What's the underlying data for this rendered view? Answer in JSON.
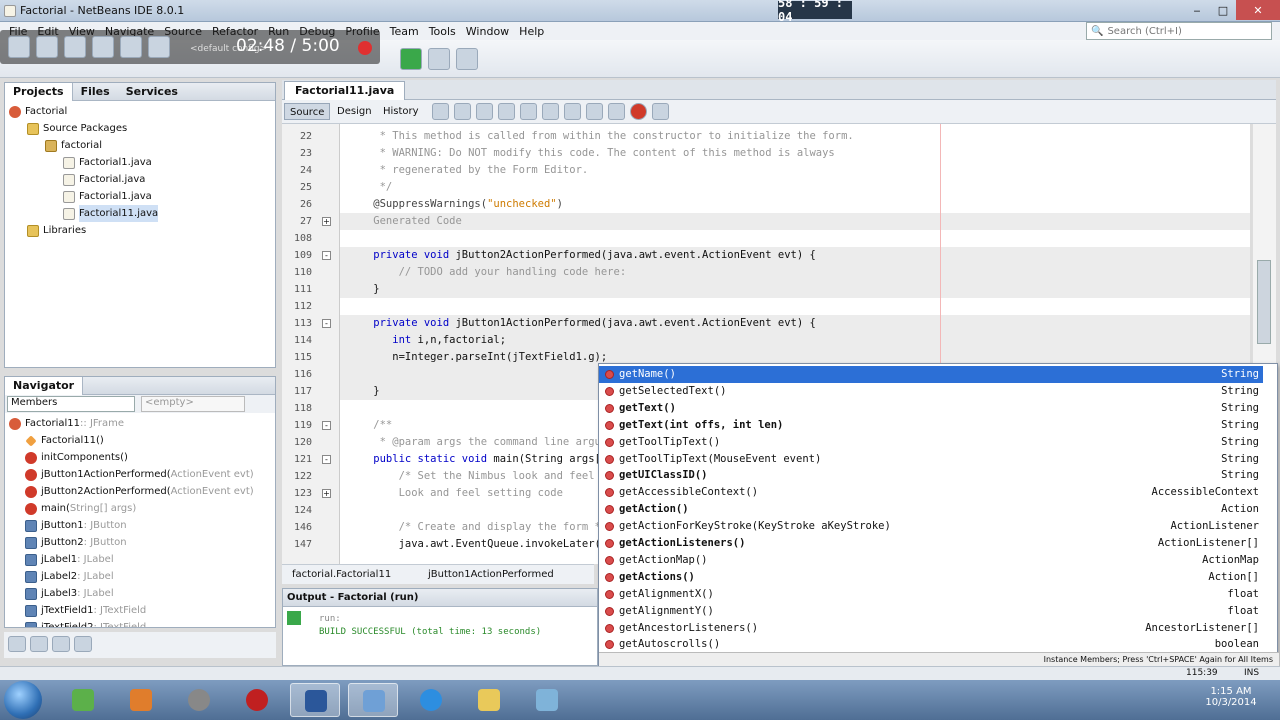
{
  "window": {
    "title": "Factorial - NetBeans IDE 8.0.1",
    "min": "‒",
    "max": "□",
    "close": "✕"
  },
  "recorder": {
    "clock": "58 : 59 : 04",
    "time": "02:48 / 5:00"
  },
  "menu": [
    "File",
    "Edit",
    "View",
    "Navigate",
    "Source",
    "Refactor",
    "Run",
    "Debug",
    "Profile",
    "Team",
    "Tools",
    "Window",
    "Help"
  ],
  "toolbar": {
    "config": "<default config>",
    "search_placeholder": "Search (Ctrl+I)"
  },
  "projects": {
    "tabs": [
      "Projects",
      "Files",
      "Services"
    ],
    "tree": [
      {
        "label": "Factorial",
        "icon": "project-icon",
        "level": 0
      },
      {
        "label": "Source Packages",
        "icon": "folder-icon",
        "level": 1
      },
      {
        "label": "factorial",
        "icon": "package-icon",
        "level": 2
      },
      {
        "label": "Factorial1.java",
        "icon": "java-file-icon",
        "level": 3
      },
      {
        "label": "Factorial.java",
        "icon": "java-file-icon",
        "level": 3
      },
      {
        "label": "Factorial1.java",
        "icon": "java-file-icon",
        "level": 3
      },
      {
        "label": "Factorial11.java",
        "icon": "java-file-icon",
        "level": 3,
        "selected": true
      },
      {
        "label": "Libraries",
        "icon": "library-icon",
        "level": 1
      }
    ]
  },
  "navigator": {
    "title": "Navigator",
    "members": "Members",
    "filter": "<empty>",
    "items": [
      {
        "name": "Factorial11",
        "type": " :: JFrame",
        "icon": "class-icon"
      },
      {
        "name": "Factorial11()",
        "type": "",
        "icon": "constructor-icon"
      },
      {
        "name": "initComponents()",
        "type": "",
        "icon": "method-icon"
      },
      {
        "name": "jButton1ActionPerformed(",
        "type": "ActionEvent evt)",
        "icon": "method-icon"
      },
      {
        "name": "jButton2ActionPerformed(",
        "type": "ActionEvent evt)",
        "icon": "method-icon"
      },
      {
        "name": "main(",
        "type": "String[] args)",
        "icon": "method-icon"
      },
      {
        "name": "jButton1",
        "type": " : JButton",
        "icon": "field-icon"
      },
      {
        "name": "jButton2",
        "type": " : JButton",
        "icon": "field-icon"
      },
      {
        "name": "jLabel1",
        "type": " : JLabel",
        "icon": "field-icon"
      },
      {
        "name": "jLabel2",
        "type": " : JLabel",
        "icon": "field-icon"
      },
      {
        "name": "jLabel3",
        "type": " : JLabel",
        "icon": "field-icon"
      },
      {
        "name": "jTextField1",
        "type": " : JTextField",
        "icon": "field-icon"
      },
      {
        "name": "jTextField2",
        "type": " : JTextField",
        "icon": "field-icon"
      }
    ]
  },
  "editor": {
    "tab": "Factorial11.java",
    "modes": [
      "Source",
      "Design",
      "History"
    ],
    "lines": [
      {
        "n": "22",
        "parts": [
          {
            "c": "cm",
            "t": "     * This method is called from within the constructor to initialize the form."
          }
        ]
      },
      {
        "n": "23",
        "parts": [
          {
            "c": "cm",
            "t": "     * WARNING: Do NOT modify this code. The content of this method is always"
          }
        ]
      },
      {
        "n": "24",
        "parts": [
          {
            "c": "cm",
            "t": "     * regenerated by the Form Editor."
          }
        ]
      },
      {
        "n": "25",
        "parts": [
          {
            "c": "cm",
            "t": "     */"
          }
        ]
      },
      {
        "n": "26",
        "parts": [
          {
            "c": "an",
            "t": "    @SuppressWarnings("
          },
          {
            "c": "st",
            "t": "\"unchecked\""
          },
          {
            "c": "an",
            "t": ")"
          }
        ]
      },
      {
        "n": "27",
        "gray": true,
        "parts": [
          {
            "c": "cm",
            "t": "    Generated Code"
          }
        ]
      },
      {
        "n": "108",
        "parts": [
          {
            "c": "",
            "t": ""
          }
        ]
      },
      {
        "n": "109",
        "gray": true,
        "parts": [
          {
            "c": "kw",
            "t": "    private void "
          },
          {
            "c": "",
            "t": "jButton2ActionPerformed(java.awt.event.ActionEvent evt) {"
          }
        ]
      },
      {
        "n": "110",
        "gray": true,
        "parts": [
          {
            "c": "cm",
            "t": "        // TODO add your handling code here:"
          }
        ]
      },
      {
        "n": "111",
        "gray": true,
        "parts": [
          {
            "c": "",
            "t": "    }"
          }
        ]
      },
      {
        "n": "112",
        "parts": [
          {
            "c": "",
            "t": ""
          }
        ]
      },
      {
        "n": "113",
        "gray": true,
        "parts": [
          {
            "c": "kw",
            "t": "    private void "
          },
          {
            "c": "",
            "t": "jButton1ActionPerformed(java.awt.event.ActionEvent evt) {"
          }
        ]
      },
      {
        "n": "114",
        "gray": true,
        "parts": [
          {
            "c": "kw",
            "t": "       int "
          },
          {
            "c": "",
            "t": "i,n,factorial;"
          }
        ]
      },
      {
        "n": "115",
        "gray": true,
        "parts": [
          {
            "c": "",
            "t": "       n=Integer.parseInt(jTextField1.g);"
          }
        ]
      },
      {
        "n": "116",
        "gray": true,
        "parts": [
          {
            "c": "",
            "t": ""
          }
        ]
      },
      {
        "n": "117",
        "gray": true,
        "parts": [
          {
            "c": "",
            "t": "    }"
          }
        ]
      },
      {
        "n": "118",
        "parts": [
          {
            "c": "",
            "t": ""
          }
        ]
      },
      {
        "n": "119",
        "parts": [
          {
            "c": "cm",
            "t": "    /**"
          }
        ]
      },
      {
        "n": "120",
        "parts": [
          {
            "c": "cm",
            "t": "     * @param args the command line arguments"
          }
        ]
      },
      {
        "n": "121",
        "parts": [
          {
            "c": "kw",
            "t": "    public static void "
          },
          {
            "c": "",
            "t": "main(String args[]) {"
          }
        ]
      },
      {
        "n": "122",
        "parts": [
          {
            "c": "cm",
            "t": "        /* Set the Nimbus look and feel */"
          }
        ]
      },
      {
        "n": "123",
        "parts": [
          {
            "c": "cm",
            "t": "        Look and feel setting code"
          }
        ]
      },
      {
        "n": "124",
        "parts": [
          {
            "c": "",
            "t": ""
          }
        ]
      },
      {
        "n": "146",
        "parts": [
          {
            "c": "cm",
            "t": "        /* Create and display the form */"
          }
        ]
      },
      {
        "n": "147",
        "parts": [
          {
            "c": "",
            "t": "        java.awt.EventQueue.invokeLater(new Runnable() {"
          }
        ]
      }
    ]
  },
  "completion": {
    "items": [
      {
        "name": "getName()",
        "type": "String",
        "selected": true
      },
      {
        "name": "getSelectedText()",
        "type": "String"
      },
      {
        "name": "getText()",
        "type": "String"
      },
      {
        "name": "getText(int offs, int len)",
        "type": "String"
      },
      {
        "name": "getToolTipText()",
        "type": "String"
      },
      {
        "name": "getToolTipText(MouseEvent event)",
        "type": "String"
      },
      {
        "name": "getUIClassID()",
        "type": "String"
      },
      {
        "name": "getAccessibleContext()",
        "type": "AccessibleContext"
      },
      {
        "name": "getAction()",
        "type": "Action"
      },
      {
        "name": "getActionForKeyStroke(KeyStroke aKeyStroke)",
        "type": "ActionListener"
      },
      {
        "name": "getActionListeners()",
        "type": "ActionListener[]"
      },
      {
        "name": "getActionMap()",
        "type": "ActionMap"
      },
      {
        "name": "getActions()",
        "type": "Action[]"
      },
      {
        "name": "getAlignmentX()",
        "type": "float"
      },
      {
        "name": "getAlignmentY()",
        "type": "float"
      },
      {
        "name": "getAncestorListeners()",
        "type": "AncestorListener[]"
      },
      {
        "name": "getAutoscrolls()",
        "type": "boolean"
      }
    ],
    "footer": "Instance Members; Press 'Ctrl+SPACE' Again for All Items"
  },
  "breadcrumb": [
    "factorial.Factorial11",
    "jButton1ActionPerformed"
  ],
  "output": {
    "title": "Output - Factorial (run)",
    "lines": [
      "run:",
      "BUILD SUCCESSFUL (total time: 13 seconds)"
    ]
  },
  "status": {
    "position": "115:39",
    "mode": "INS"
  },
  "tray": {
    "time": "1:15 AM",
    "date": "10/3/2014"
  }
}
